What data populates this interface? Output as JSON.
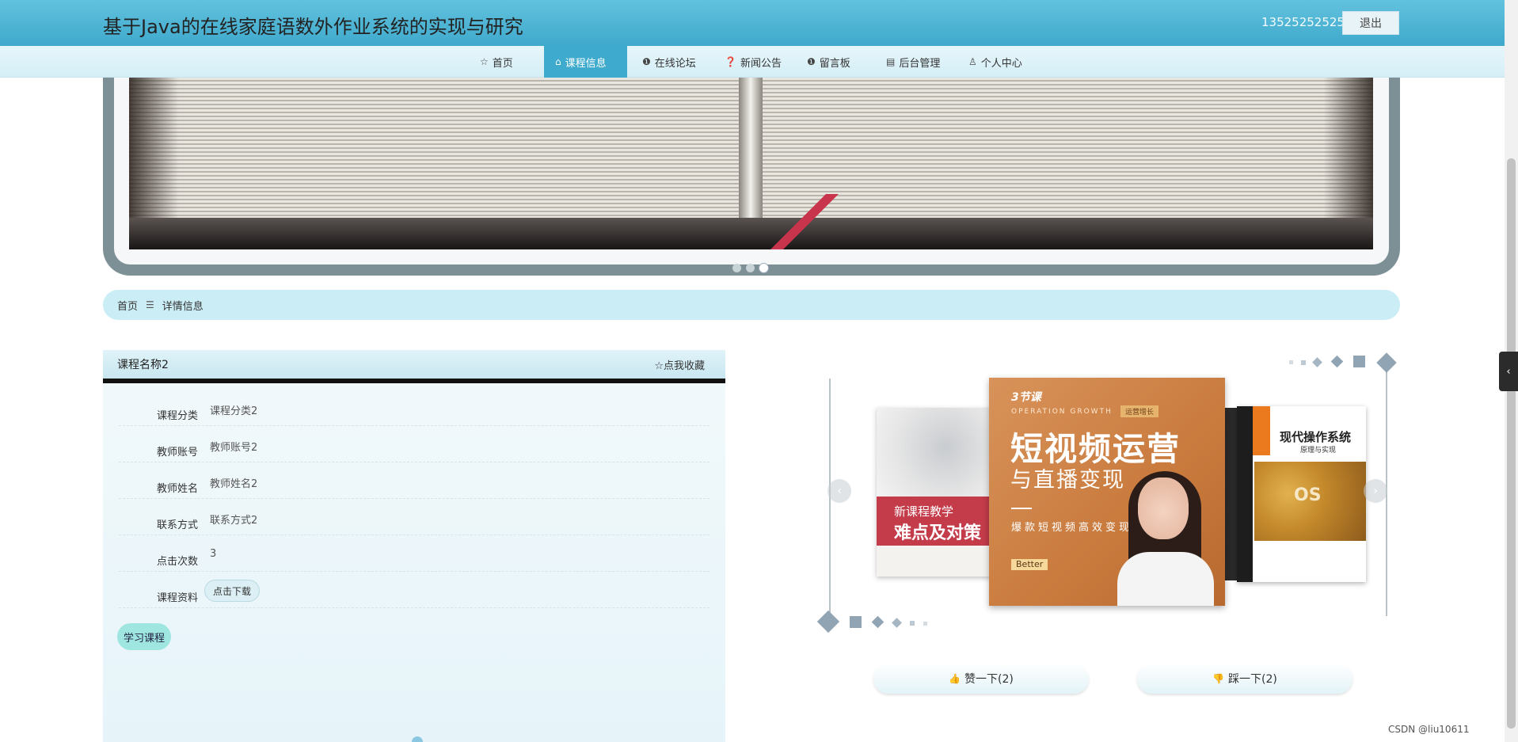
{
  "header": {
    "site_title": "基于Java的在线家庭语数外作业系统的实现与研究",
    "user_phone": "13525252525",
    "logout_label": "退出"
  },
  "nav": {
    "items": [
      {
        "label": "首页",
        "icon": "star-icon"
      },
      {
        "label": "课程信息",
        "icon": "home-icon",
        "active": true
      },
      {
        "label": "在线论坛",
        "icon": "info-icon"
      },
      {
        "label": "新闻公告",
        "icon": "question-icon"
      },
      {
        "label": "留言板",
        "icon": "info-icon"
      },
      {
        "label": "后台管理",
        "icon": "building-icon"
      },
      {
        "label": "个人中心",
        "icon": "user-icon"
      }
    ]
  },
  "banner": {
    "dots": 3,
    "active_dot": 3
  },
  "breadcrumb": {
    "home": "首页",
    "separator": "☰",
    "current": "详情信息"
  },
  "detail": {
    "title": "课程名称2",
    "favorite_label": "☆点我收藏",
    "rows": [
      {
        "label": "课程分类",
        "value": "课程分类2"
      },
      {
        "label": "教师账号",
        "value": "教师账号2"
      },
      {
        "label": "教师姓名",
        "value": "教师姓名2"
      },
      {
        "label": "联系方式",
        "value": "联系方式2"
      },
      {
        "label": "点击次数",
        "value": "3"
      },
      {
        "label": "课程资料",
        "value": ""
      }
    ],
    "download_label": "点击下载",
    "study_label": "学习课程"
  },
  "carousel": {
    "left_book": {
      "line1": "新课程教学",
      "line2": "难点及对策"
    },
    "center_book": {
      "brand": "3节课",
      "tag": "运营增长",
      "title1": "短视频运营",
      "title2": "与直播变现",
      "subtitle": "爆款短视频高效变现",
      "badge": "Better"
    },
    "right_book": {
      "title": "现代操作系统",
      "subtitle": "原理与实现",
      "mark": "OS"
    }
  },
  "votes": {
    "like_label": "赞一下(2)",
    "dislike_label": "踩一下(2)"
  },
  "watermark": "CSDN @liu10611",
  "colors": {
    "header": "#3fa9cc",
    "nav_active": "#3eaacd",
    "breadcrumb": "#cbeef6",
    "study_button": "#9ee6df"
  }
}
